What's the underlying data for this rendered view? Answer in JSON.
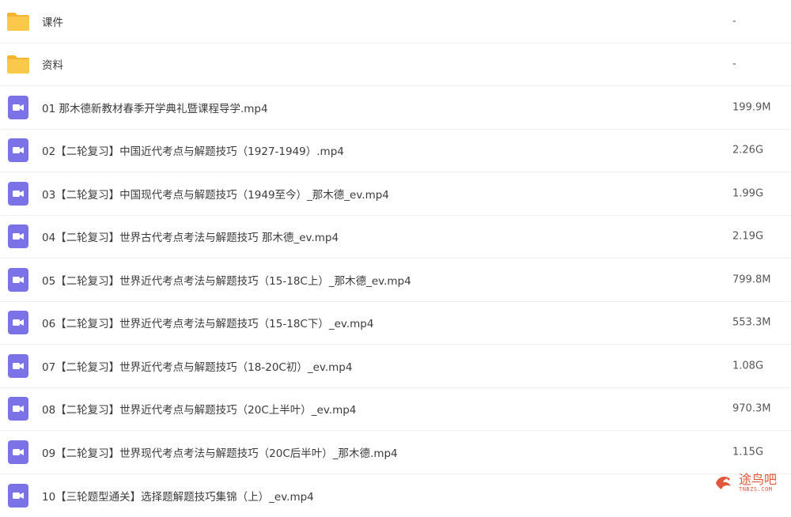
{
  "files": [
    {
      "type": "folder",
      "name": "课件",
      "size": "-"
    },
    {
      "type": "folder",
      "name": "资料",
      "size": "-"
    },
    {
      "type": "video",
      "name": "01 那木德新教材春季开学典礼暨课程导学.mp4",
      "size": "199.9M"
    },
    {
      "type": "video",
      "name": "02【二轮复习】中国近代考点与解题技巧（1927-1949）.mp4",
      "size": "2.26G"
    },
    {
      "type": "video",
      "name": "03【二轮复习】中国现代考点与解题技巧（1949至今）_那木德_ev.mp4",
      "size": "1.99G"
    },
    {
      "type": "video",
      "name": "04【二轮复习】世界古代考点考法与解题技巧 那木德_ev.mp4",
      "size": "2.19G"
    },
    {
      "type": "video",
      "name": "05【二轮复习】世界近代考点考法与解题技巧（15-18C上）_那木德_ev.mp4",
      "size": "799.8M"
    },
    {
      "type": "video",
      "name": "06【二轮复习】世界近代考点考法与解题技巧（15-18C下）_ev.mp4",
      "size": "553.3M"
    },
    {
      "type": "video",
      "name": "07【二轮复习】世界近代考点与解题技巧（18-20C初）_ev.mp4",
      "size": "1.08G"
    },
    {
      "type": "video",
      "name": "08【二轮复习】世界近代考点与解题技巧（20C上半叶）_ev.mp4",
      "size": "970.3M"
    },
    {
      "type": "video",
      "name": "09【二轮复习】世界现代考点考法与解题技巧（20C后半叶）_那木德.mp4",
      "size": "1.15G"
    },
    {
      "type": "video",
      "name": "10【三轮题型通关】选择题解题技巧集锦（上）_ev.mp4",
      "size": ""
    }
  ],
  "colors": {
    "folder": "#fbc94a",
    "folder_tab": "#f5b531",
    "video": "#7b72e8",
    "divider": "#eef0f4",
    "watermark": "#e0573b"
  },
  "icons": {
    "folder": "folder-icon",
    "video": "video-file-icon",
    "watermark": "bird-logo-icon"
  },
  "watermark": {
    "text": "途鸟吧",
    "sub": "TNBZS.COM"
  }
}
